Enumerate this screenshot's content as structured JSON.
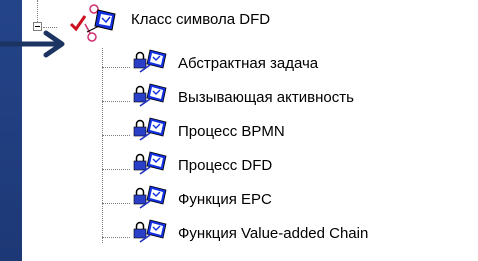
{
  "tree": {
    "parent": {
      "label": "Класс символа DFD",
      "icon": "user-permission-icon",
      "marker_color": "#e0152b",
      "check_color": "#cc1020"
    },
    "children": [
      {
        "label": "Абстрактная задача",
        "icon": "locked-permission-icon"
      },
      {
        "label": "Вызывающая активность",
        "icon": "locked-permission-icon"
      },
      {
        "label": "Процесс BPMN",
        "icon": "locked-permission-icon"
      },
      {
        "label": "Процесс DFD",
        "icon": "locked-permission-icon"
      },
      {
        "label": "Функция EPC",
        "icon": "locked-permission-icon"
      },
      {
        "label": "Функция Value-added Chain",
        "icon": "locked-permission-icon"
      }
    ]
  },
  "colors": {
    "background": "#1f3a78",
    "annotation_arrow": "#1c3461",
    "lock": "#2a3fc8",
    "monitor_blue": "#1230e0",
    "curl_red": "#d03070"
  }
}
